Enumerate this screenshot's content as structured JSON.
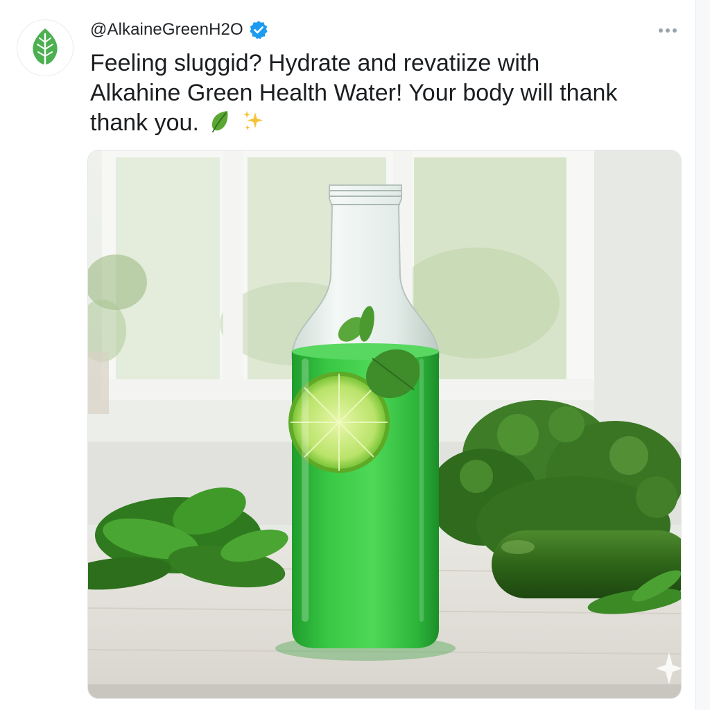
{
  "tweet": {
    "handle": "@AlkaineGreenH2O",
    "verified": true,
    "text_line1": "Feeling sluggid? Hydrate and revatiize with",
    "text_line2": "Alkahine Green Health Water! Your body will thank",
    "text_line3": "thank you.",
    "emojis": [
      "leaf-icon",
      "sparkles-icon"
    ]
  },
  "icons": {
    "avatar": "leaf-icon",
    "verified": "verified-badge-icon",
    "more": "more-options-icon",
    "media_watermark": "sparkle-watermark-icon"
  },
  "colors": {
    "brand_green": "#4caf50",
    "verified_blue": "#1d9bf0",
    "text": "#1b1e21",
    "drink_green": "#2fbf3a"
  }
}
